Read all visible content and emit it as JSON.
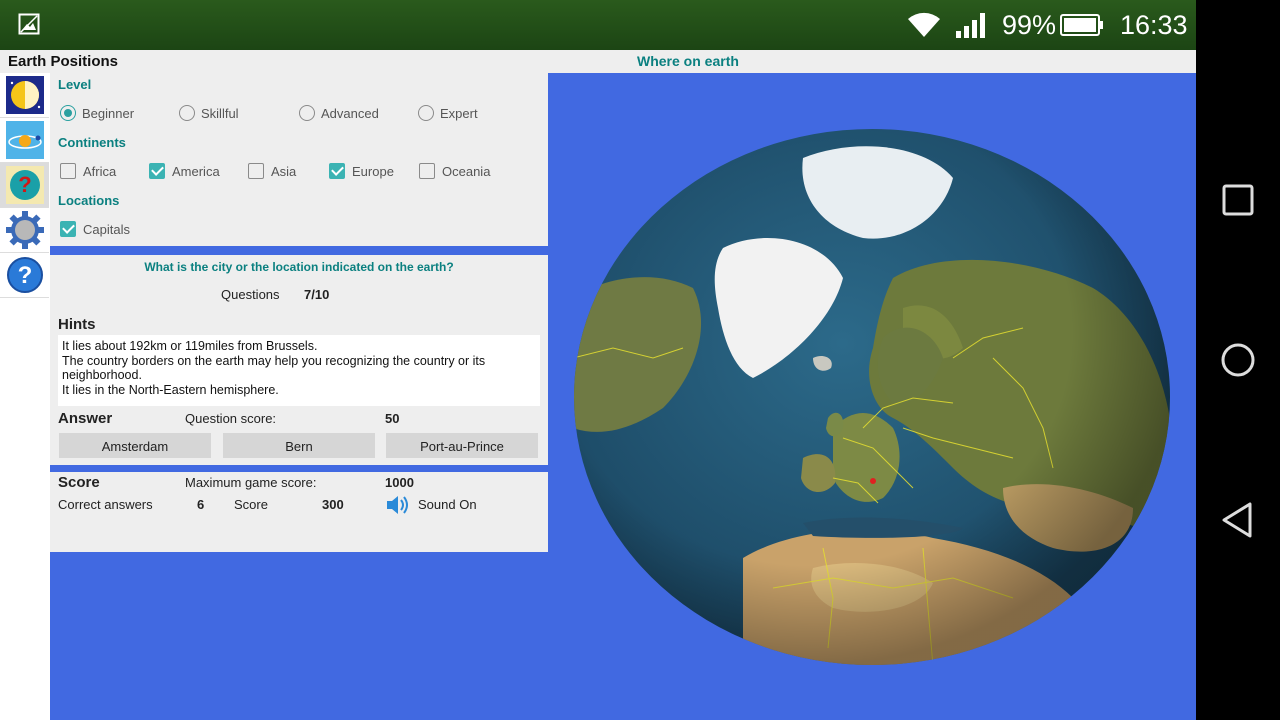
{
  "status_bar": {
    "battery_percent": "99%",
    "time": "16:33",
    "icons": [
      "gallery-icon",
      "wifi-icon",
      "signal-icon",
      "battery-icon"
    ]
  },
  "app": {
    "title": "Earth Positions",
    "globe_title": "Where on earth",
    "sidebar": {
      "icons": [
        "day-night-icon",
        "solar-system-icon",
        "quiz-icon",
        "settings-gear-icon",
        "help-icon"
      ],
      "active_index": 2
    },
    "level": {
      "label": "Level",
      "options": [
        {
          "label": "Beginner",
          "selected": true
        },
        {
          "label": "Skillful",
          "selected": false
        },
        {
          "label": "Advanced",
          "selected": false
        },
        {
          "label": "Expert",
          "selected": false
        }
      ]
    },
    "continents": {
      "label": "Continents",
      "options": [
        {
          "label": "Africa",
          "checked": false
        },
        {
          "label": "America",
          "checked": true
        },
        {
          "label": "Asia",
          "checked": false
        },
        {
          "label": "Europe",
          "checked": true
        },
        {
          "label": "Oceania",
          "checked": false
        }
      ]
    },
    "locations": {
      "label": "Locations",
      "options": [
        {
          "label": "Capitals",
          "checked": true
        }
      ]
    },
    "quiz": {
      "question": "What is the city or the location indicated on the earth?",
      "questions_label": "Questions",
      "questions_value": "7/10",
      "hints_label": "Hints",
      "hints": [
        "It lies about 192km or 119miles from Brussels.",
        "The country borders on the earth may help you recognizing the country or its neighborhood.",
        "It lies in the North-Eastern hemisphere."
      ],
      "answer_label": "Answer",
      "question_score_label": "Question score:",
      "question_score_value": "50",
      "answers": [
        "Amsterdam",
        "Bern",
        "Port-au-Prince"
      ]
    },
    "score": {
      "label": "Score",
      "max_label": "Maximum game score:",
      "max_value": "1000",
      "correct_label": "Correct answers",
      "correct_value": "6",
      "score_label": "Score",
      "score_value": "300",
      "sound_label": "Sound On"
    }
  },
  "colors": {
    "app_background": "#4169e1",
    "accent_teal": "#0b8080",
    "status_bar": "#214f17"
  }
}
